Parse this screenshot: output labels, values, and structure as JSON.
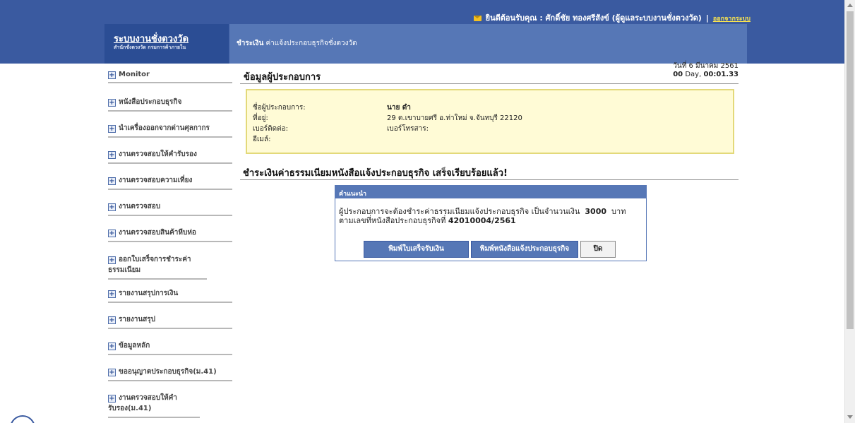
{
  "header": {
    "welcome": "ยินดีต้อนรับคุณ : ศักดิ์ชัย ทองศรีสังข์ (ผู้ดูแลระบบงานชั่งตวงวัด)",
    "separator": "|",
    "logout": "ออกจากระบบ",
    "brand_title": "ระบบงานชั่งตวงวัด",
    "brand_subtitle": "สำนักชั่งตวงวัด กรมการค้าภายใน",
    "breadcrumb_section": "ชำระเงิน",
    "breadcrumb_page": "ค่าแจ้งประกอบธุรกิจชั่งตวงวัด"
  },
  "sidebar": {
    "items": [
      {
        "label": "Monitor"
      },
      {
        "label": "หนังสือประกอบธุรกิจ"
      },
      {
        "label": "นำเครื่องออกจากด่านศุลกากร"
      },
      {
        "label": "งานตรวจสอบให้คำรับรอง"
      },
      {
        "label": "งานตรวจสอบความเที่ยง"
      },
      {
        "label": "งานตรวจสอบ"
      },
      {
        "label": "งานตรวจสอบสินค้าหีบห่อ"
      },
      {
        "label": "ออกใบเสร็จการชำระค่าธรรมเนียม"
      },
      {
        "label": "รายงานสรุปการเงิน"
      },
      {
        "label": "รายงานสรุป"
      },
      {
        "label": "ข้อมูลหลัก"
      },
      {
        "label": "ขออนุญาตประกอบธุรกิจ(ม.41)"
      },
      {
        "label": "งานตรวจสอบให้คำรับรอง(ม.41)"
      }
    ]
  },
  "main": {
    "title": "ข้อมูลผู้ประกอบการ",
    "date_line": "วันที่ 6 มีนาคม 2561",
    "timer_days": "00",
    "timer_label": "Day,",
    "timer_time": "00:01.33",
    "info": {
      "name_label": "ชื่อผู้ประกอบการ:",
      "name_value": "นาย ดำ",
      "address_label": "ที่อยู่:",
      "address_value": "29 ต.เขาบายศรี อ.ท่าใหม่ จ.จันทบุรี 22120",
      "phone_label": "เบอร์ติดต่อ:",
      "fax_label": "เบอร์โทรสาร:",
      "email_label": "อีเมล์:"
    },
    "success_message": "ชำระเงินค่าธรรมเนียมหนังสือแจ้งประกอบธุรกิจ เสร็จเรียบร้อยแล้ว!"
  },
  "dialog": {
    "title": "คำแนะนำ",
    "line1_prefix": "ผู้ประกอบการจะต้องชำระค่าธรรมเนียมแจ้งประกอบธุรกิจ เป็นจำนวนเงิน",
    "amount": "3000",
    "currency": "บาท",
    "line2_prefix": "ตามเลขที่หนังสือประกอบธุรกิจที่",
    "doc_number": "42010004/2561",
    "btn_receipt": "พิมพ์ใบเสร็จรับเงิน",
    "btn_print_doc": "พิมพ์หนังสือแจ้งประกอบธุรกิจ",
    "btn_close": "ปิด"
  }
}
